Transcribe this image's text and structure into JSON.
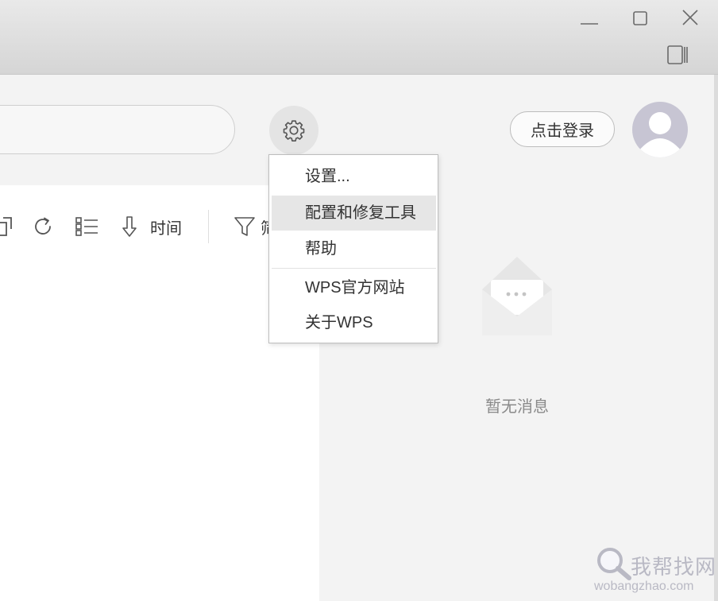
{
  "toolbar": {
    "sort_label": "时间",
    "filter_label": "筛选"
  },
  "header": {
    "login_label": "点击登录"
  },
  "settings_menu": {
    "items": [
      {
        "label": "设置..."
      },
      {
        "label": "配置和修复工具"
      },
      {
        "label": "帮助"
      },
      {
        "label": "WPS官方网站"
      },
      {
        "label": "关于WPS"
      }
    ],
    "highlighted_index": 1
  },
  "messages": {
    "empty_text": "暂无消息"
  },
  "watermark": {
    "title": "我帮找网",
    "domain": "wobangzhao.com"
  },
  "icons": {
    "minimize": "minimize-icon",
    "maximize": "maximize-icon",
    "close": "close-icon",
    "side_panel": "side-panel-icon",
    "settings": "gear-icon",
    "avatar": "user-avatar-icon",
    "share": "share-icon",
    "refresh": "refresh-icon",
    "list_view": "list-view-icon",
    "sort": "arrow-down-icon",
    "filter": "filter-icon",
    "empty_messages": "envelope-icon",
    "watermark": "magnifier-icon"
  },
  "colors": {
    "titlebar": "#dedede",
    "menu_highlight": "#e6e6e6",
    "avatar_bg": "#c7c5d3",
    "muted_text": "#8a8a8a"
  }
}
